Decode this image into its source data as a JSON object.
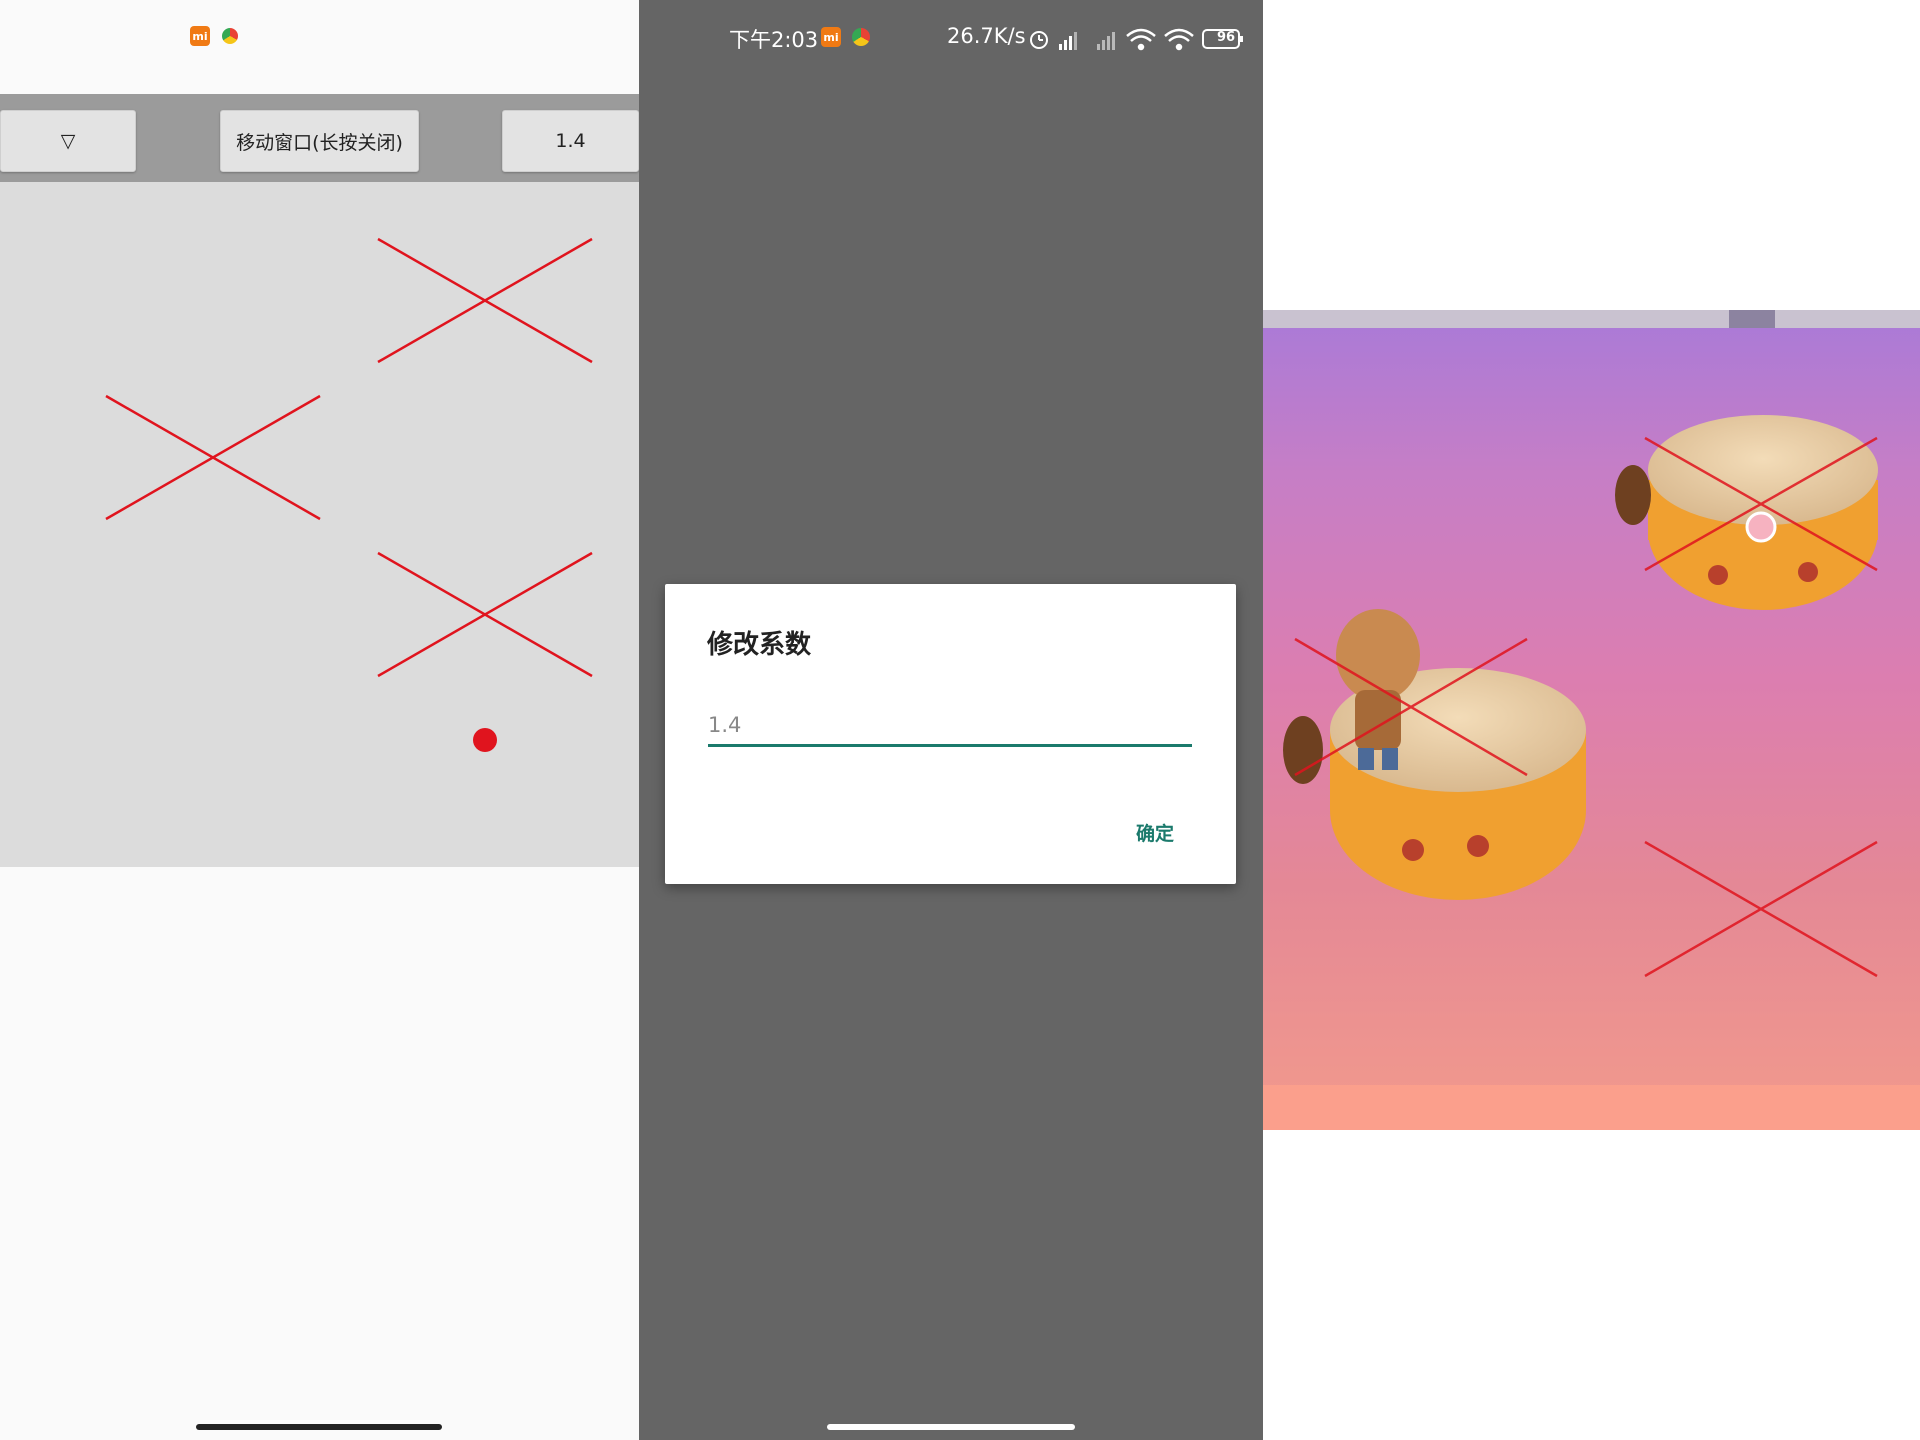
{
  "left_panel": {
    "toolbar": {
      "dropdown_label": "▽",
      "move_window_label": "移动窗口(长按关闭)",
      "coefficient_label": "1.4"
    }
  },
  "middle_panel": {
    "status_bar": {
      "time": "下午2:03",
      "net_speed": "26.7K/s",
      "battery": "96"
    },
    "dialog": {
      "title": "修改系数",
      "input_value": "1.4",
      "confirm_label": "确定"
    }
  },
  "colors": {
    "marker_red": "#e0141e",
    "accent_teal": "#1b7a6c",
    "overlay_gray": "#dcdcdc",
    "dim_background": "#656565"
  }
}
